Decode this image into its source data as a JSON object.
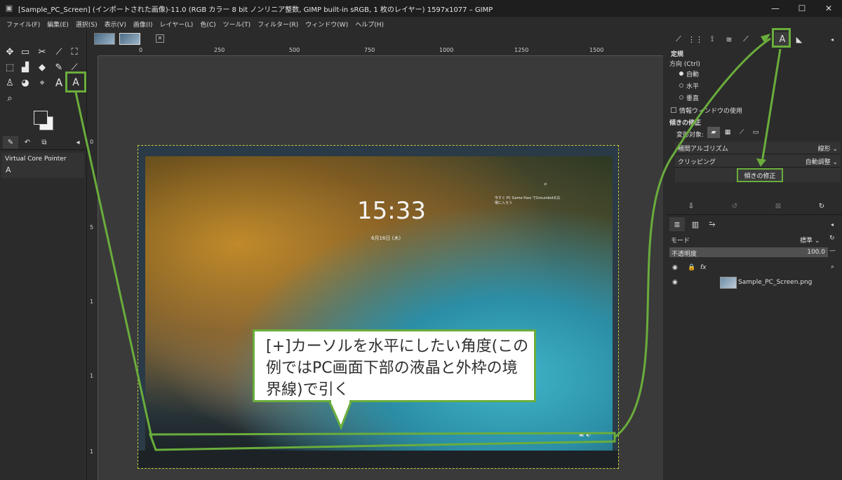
{
  "window": {
    "title": "[Sample_PC_Screen] (インポートされた画像)-11.0 (RGB カラー 8 bit ノンリニア整数, GIMP built-in sRGB, 1 枚のレイヤー) 1597x1077 – GIMP",
    "minimize": "—",
    "maximize": "☐",
    "close": "✕"
  },
  "menu": [
    "ファイル(F)",
    "編集(E)",
    "選択(S)",
    "表示(V)",
    "画像(I)",
    "レイヤー(L)",
    "色(C)",
    "ツール(T)",
    "フィルター(R)",
    "ウィンドウ(W)",
    "ヘルプ(H)"
  ],
  "toolbox": {
    "tools_row1": [
      "✥",
      "▭",
      "✂",
      "⟋",
      "⛶"
    ],
    "tools_row2": [
      "⬚",
      "▟",
      "◆",
      "✎",
      "⟋"
    ],
    "tools_row3": [
      "♙",
      "◕",
      "⌖",
      "A",
      "A"
    ],
    "tools_row4": [
      "⌕"
    ],
    "device_label": "Virtual Core Pointer",
    "device_icon": "A"
  },
  "rulers": {
    "top": [
      "0",
      "250",
      "500",
      "750",
      "1000",
      "1250",
      "1500"
    ],
    "left": [
      "0",
      "5",
      "1",
      "1",
      "1"
    ]
  },
  "photo": {
    "clock": "15:33",
    "date": "6月16日 (木)",
    "promo": "今すぐ PC Game Pass でGroundedの広場に入ろう",
    "search_icon": "⌕"
  },
  "tool_options": {
    "section_title": "定規",
    "orientation_label": "方向 (Ctrl)",
    "orientation_options": [
      "自動",
      "水平",
      "垂直"
    ],
    "orientation_selected": "自動",
    "info_window_label": "情報ウィンドウの使用",
    "straighten_section": "傾きの修正",
    "transform_target_label": "変形対象:",
    "interpolation_label": "補間アルゴリズム",
    "interpolation_value": "線形 ⌄",
    "clipping_label": "クリッピング",
    "clipping_value": "自動調整 ⌄",
    "straighten_button": "傾きの修正"
  },
  "layers": {
    "mode_label": "モード",
    "mode_value": "標準 ⌄",
    "opacity_label": "不透明度",
    "opacity_value": "100.0",
    "layer_name": "Sample_PC_Screen.png"
  },
  "annotation": {
    "text": "[+]カーソルを水平にしたい角度(この例ではPC画面下部の液晶と外枠の境界線)で引く",
    "accent_color": "#6aad3c"
  }
}
